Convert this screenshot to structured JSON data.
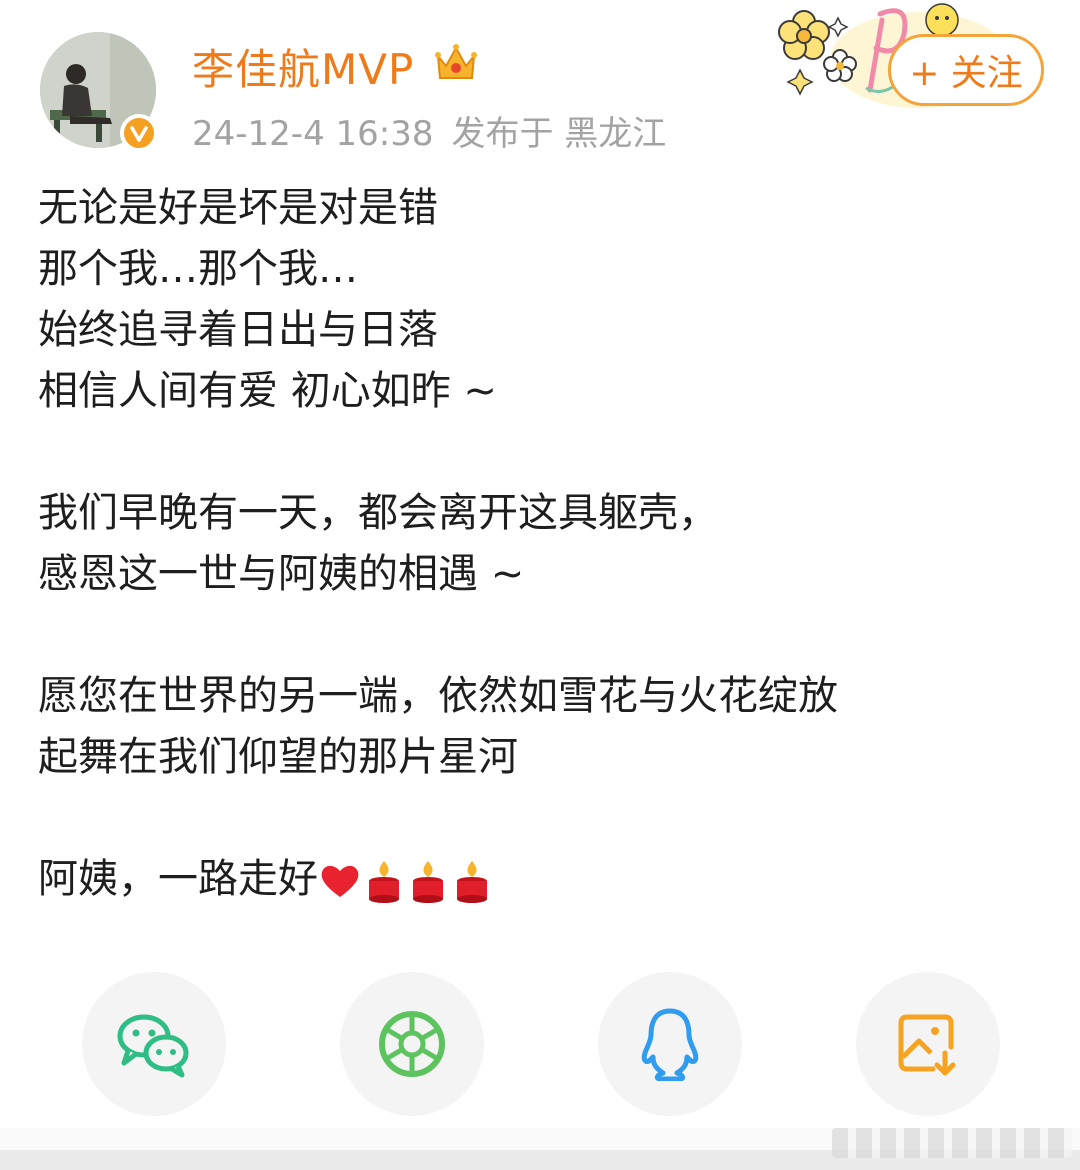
{
  "post": {
    "author": "李佳航MVP",
    "timestamp": "24-12-4 16:38",
    "location": "发布于 黑龙江",
    "follow_label": "+ 关注",
    "lines": [
      "无论是好是坏是对是错",
      "那个我…那个我…",
      "始终追寻着日出与日落",
      "相信人间有爱 初心如昨 ~",
      "",
      "我们早晚有一天，都会离开这具躯壳，",
      "感恩这一世与阿姨的相遇 ~",
      "",
      "愿您在世界的另一端，依然如雪花与火花绽放",
      "起舞在我们仰望的那片星河",
      "",
      "阿姨，一路走好"
    ],
    "closing_emojis": [
      "heart-emoji",
      "candle-emoji",
      "candle-emoji",
      "candle-emoji"
    ]
  },
  "share": [
    {
      "name": "wechat",
      "icon": "wechat-icon",
      "color": "#2dbd85"
    },
    {
      "name": "moments",
      "icon": "moments-icon",
      "color": "#5cc35f"
    },
    {
      "name": "qq",
      "icon": "qq-icon",
      "color": "#2f9cf0"
    },
    {
      "name": "save-image",
      "icon": "save-image-icon",
      "color": "#f5a320"
    }
  ],
  "colors": {
    "accent": "#ef7a1a",
    "meta_text": "#a3a3a3",
    "follow_border": "#f5a43a"
  }
}
